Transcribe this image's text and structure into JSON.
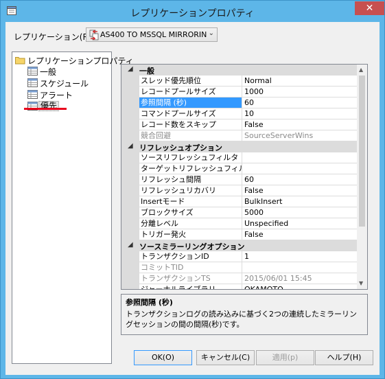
{
  "window": {
    "title": "レプリケーションプロパティ",
    "close_glyph": "✕"
  },
  "replication": {
    "label": "レプリケーション(R)",
    "selected": "AS400 TO MSSQL MIRRORIN",
    "arrow": "⌄"
  },
  "tree": {
    "root": "レプリケーションプロパティ",
    "items": [
      "一般",
      "スケジュール",
      "アラート",
      "優先"
    ],
    "selected_item": "優先"
  },
  "grid": {
    "categories": [
      {
        "name": "一般",
        "expanded_glyph": "◢",
        "rows": [
          {
            "name": "スレッド優先順位",
            "value": "Normal"
          },
          {
            "name": "レコードプールサイズ",
            "value": "1000"
          },
          {
            "name": "参照間隔 (秒)",
            "value": "60",
            "selected": true
          },
          {
            "name": "コマンドプールサイズ",
            "value": "10"
          },
          {
            "name": "レコード数をスキップ",
            "value": "False"
          },
          {
            "name": "競合回避",
            "value": "SourceServerWins",
            "disabled": true
          }
        ]
      },
      {
        "name": "リフレッシュオプション",
        "expanded_glyph": "◢",
        "rows": [
          {
            "name": "ソースリフレッシュフィルタ",
            "value": ""
          },
          {
            "name": "ターゲットリフレッシュフィルタ",
            "value": ""
          },
          {
            "name": "リフレッシュ間隔",
            "value": "60"
          },
          {
            "name": "リフレッシュリカバリ",
            "value": "False"
          },
          {
            "name": "Insertモード",
            "value": "BulkInsert"
          },
          {
            "name": "ブロックサイズ",
            "value": "5000"
          },
          {
            "name": "分離レベル",
            "value": "Unspecified"
          },
          {
            "name": "トリガー発火",
            "value": "False"
          }
        ]
      },
      {
        "name": "ソースミラーリングオプション",
        "expanded_glyph": "◢",
        "rows": [
          {
            "name": "トランザクションID",
            "value": "1"
          },
          {
            "name": "コミットTID",
            "value": "",
            "disabled": true
          },
          {
            "name": "トランザクションTS",
            "value": "2015/06/01 15:45",
            "disabled": true
          },
          {
            "name": "ジャーナルライブラリ",
            "value": "OKAMOTO"
          }
        ]
      }
    ]
  },
  "description": {
    "title": "参照間隔 (秒)",
    "text": "トランザクションログの読み込みに基づく2つの連続したミラーリングセッションの間の間隔(秒)です。"
  },
  "buttons": {
    "ok": "OK(O)",
    "cancel": "キャンセル(C)",
    "apply": "適用(p)",
    "help": "ヘルプ(H)"
  },
  "colors": {
    "accent": "#3399ff",
    "titlebar": "#5db6e8",
    "close": "#c75050",
    "annotation": "#e8001c"
  }
}
